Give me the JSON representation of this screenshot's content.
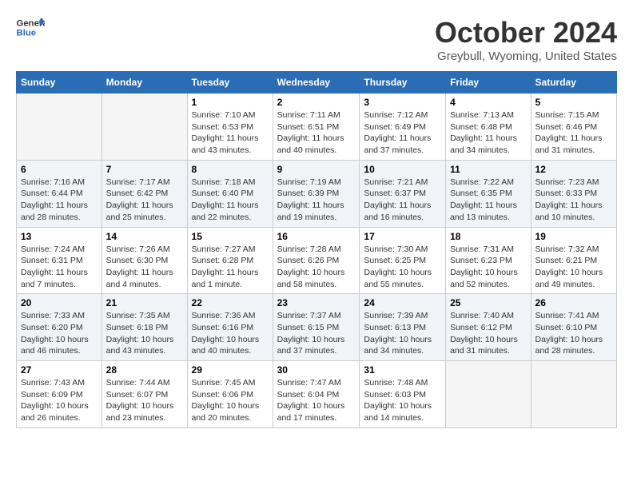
{
  "header": {
    "logo_line1": "General",
    "logo_line2": "Blue",
    "month": "October 2024",
    "location": "Greybull, Wyoming, United States"
  },
  "weekdays": [
    "Sunday",
    "Monday",
    "Tuesday",
    "Wednesday",
    "Thursday",
    "Friday",
    "Saturday"
  ],
  "weeks": [
    [
      {
        "day": "",
        "sunrise": "",
        "sunset": "",
        "daylight": "",
        "empty": true
      },
      {
        "day": "",
        "sunrise": "",
        "sunset": "",
        "daylight": "",
        "empty": true
      },
      {
        "day": "1",
        "sunrise": "Sunrise: 7:10 AM",
        "sunset": "Sunset: 6:53 PM",
        "daylight": "Daylight: 11 hours and 43 minutes.",
        "empty": false
      },
      {
        "day": "2",
        "sunrise": "Sunrise: 7:11 AM",
        "sunset": "Sunset: 6:51 PM",
        "daylight": "Daylight: 11 hours and 40 minutes.",
        "empty": false
      },
      {
        "day": "3",
        "sunrise": "Sunrise: 7:12 AM",
        "sunset": "Sunset: 6:49 PM",
        "daylight": "Daylight: 11 hours and 37 minutes.",
        "empty": false
      },
      {
        "day": "4",
        "sunrise": "Sunrise: 7:13 AM",
        "sunset": "Sunset: 6:48 PM",
        "daylight": "Daylight: 11 hours and 34 minutes.",
        "empty": false
      },
      {
        "day": "5",
        "sunrise": "Sunrise: 7:15 AM",
        "sunset": "Sunset: 6:46 PM",
        "daylight": "Daylight: 11 hours and 31 minutes.",
        "empty": false
      }
    ],
    [
      {
        "day": "6",
        "sunrise": "Sunrise: 7:16 AM",
        "sunset": "Sunset: 6:44 PM",
        "daylight": "Daylight: 11 hours and 28 minutes.",
        "empty": false
      },
      {
        "day": "7",
        "sunrise": "Sunrise: 7:17 AM",
        "sunset": "Sunset: 6:42 PM",
        "daylight": "Daylight: 11 hours and 25 minutes.",
        "empty": false
      },
      {
        "day": "8",
        "sunrise": "Sunrise: 7:18 AM",
        "sunset": "Sunset: 6:40 PM",
        "daylight": "Daylight: 11 hours and 22 minutes.",
        "empty": false
      },
      {
        "day": "9",
        "sunrise": "Sunrise: 7:19 AM",
        "sunset": "Sunset: 6:39 PM",
        "daylight": "Daylight: 11 hours and 19 minutes.",
        "empty": false
      },
      {
        "day": "10",
        "sunrise": "Sunrise: 7:21 AM",
        "sunset": "Sunset: 6:37 PM",
        "daylight": "Daylight: 11 hours and 16 minutes.",
        "empty": false
      },
      {
        "day": "11",
        "sunrise": "Sunrise: 7:22 AM",
        "sunset": "Sunset: 6:35 PM",
        "daylight": "Daylight: 11 hours and 13 minutes.",
        "empty": false
      },
      {
        "day": "12",
        "sunrise": "Sunrise: 7:23 AM",
        "sunset": "Sunset: 6:33 PM",
        "daylight": "Daylight: 11 hours and 10 minutes.",
        "empty": false
      }
    ],
    [
      {
        "day": "13",
        "sunrise": "Sunrise: 7:24 AM",
        "sunset": "Sunset: 6:31 PM",
        "daylight": "Daylight: 11 hours and 7 minutes.",
        "empty": false
      },
      {
        "day": "14",
        "sunrise": "Sunrise: 7:26 AM",
        "sunset": "Sunset: 6:30 PM",
        "daylight": "Daylight: 11 hours and 4 minutes.",
        "empty": false
      },
      {
        "day": "15",
        "sunrise": "Sunrise: 7:27 AM",
        "sunset": "Sunset: 6:28 PM",
        "daylight": "Daylight: 11 hours and 1 minute.",
        "empty": false
      },
      {
        "day": "16",
        "sunrise": "Sunrise: 7:28 AM",
        "sunset": "Sunset: 6:26 PM",
        "daylight": "Daylight: 10 hours and 58 minutes.",
        "empty": false
      },
      {
        "day": "17",
        "sunrise": "Sunrise: 7:30 AM",
        "sunset": "Sunset: 6:25 PM",
        "daylight": "Daylight: 10 hours and 55 minutes.",
        "empty": false
      },
      {
        "day": "18",
        "sunrise": "Sunrise: 7:31 AM",
        "sunset": "Sunset: 6:23 PM",
        "daylight": "Daylight: 10 hours and 52 minutes.",
        "empty": false
      },
      {
        "day": "19",
        "sunrise": "Sunrise: 7:32 AM",
        "sunset": "Sunset: 6:21 PM",
        "daylight": "Daylight: 10 hours and 49 minutes.",
        "empty": false
      }
    ],
    [
      {
        "day": "20",
        "sunrise": "Sunrise: 7:33 AM",
        "sunset": "Sunset: 6:20 PM",
        "daylight": "Daylight: 10 hours and 46 minutes.",
        "empty": false
      },
      {
        "day": "21",
        "sunrise": "Sunrise: 7:35 AM",
        "sunset": "Sunset: 6:18 PM",
        "daylight": "Daylight: 10 hours and 43 minutes.",
        "empty": false
      },
      {
        "day": "22",
        "sunrise": "Sunrise: 7:36 AM",
        "sunset": "Sunset: 6:16 PM",
        "daylight": "Daylight: 10 hours and 40 minutes.",
        "empty": false
      },
      {
        "day": "23",
        "sunrise": "Sunrise: 7:37 AM",
        "sunset": "Sunset: 6:15 PM",
        "daylight": "Daylight: 10 hours and 37 minutes.",
        "empty": false
      },
      {
        "day": "24",
        "sunrise": "Sunrise: 7:39 AM",
        "sunset": "Sunset: 6:13 PM",
        "daylight": "Daylight: 10 hours and 34 minutes.",
        "empty": false
      },
      {
        "day": "25",
        "sunrise": "Sunrise: 7:40 AM",
        "sunset": "Sunset: 6:12 PM",
        "daylight": "Daylight: 10 hours and 31 minutes.",
        "empty": false
      },
      {
        "day": "26",
        "sunrise": "Sunrise: 7:41 AM",
        "sunset": "Sunset: 6:10 PM",
        "daylight": "Daylight: 10 hours and 28 minutes.",
        "empty": false
      }
    ],
    [
      {
        "day": "27",
        "sunrise": "Sunrise: 7:43 AM",
        "sunset": "Sunset: 6:09 PM",
        "daylight": "Daylight: 10 hours and 26 minutes.",
        "empty": false
      },
      {
        "day": "28",
        "sunrise": "Sunrise: 7:44 AM",
        "sunset": "Sunset: 6:07 PM",
        "daylight": "Daylight: 10 hours and 23 minutes.",
        "empty": false
      },
      {
        "day": "29",
        "sunrise": "Sunrise: 7:45 AM",
        "sunset": "Sunset: 6:06 PM",
        "daylight": "Daylight: 10 hours and 20 minutes.",
        "empty": false
      },
      {
        "day": "30",
        "sunrise": "Sunrise: 7:47 AM",
        "sunset": "Sunset: 6:04 PM",
        "daylight": "Daylight: 10 hours and 17 minutes.",
        "empty": false
      },
      {
        "day": "31",
        "sunrise": "Sunrise: 7:48 AM",
        "sunset": "Sunset: 6:03 PM",
        "daylight": "Daylight: 10 hours and 14 minutes.",
        "empty": false
      },
      {
        "day": "",
        "sunrise": "",
        "sunset": "",
        "daylight": "",
        "empty": true
      },
      {
        "day": "",
        "sunrise": "",
        "sunset": "",
        "daylight": "",
        "empty": true
      }
    ]
  ]
}
